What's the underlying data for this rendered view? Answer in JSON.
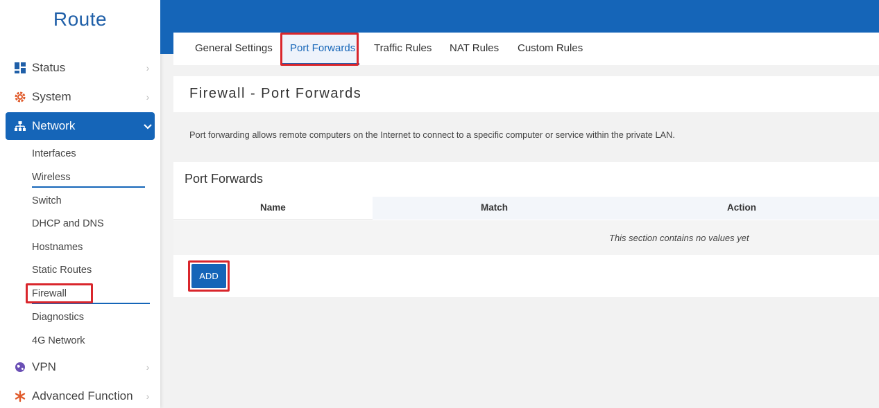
{
  "brand": "Route",
  "colors": {
    "primary": "#1565b8",
    "highlight": "#d9262c",
    "system_icon": "#e05a2b",
    "vpn_icon": "#6a4fb5",
    "advanced_icon": "#e05a2b"
  },
  "sidebar": {
    "items": [
      {
        "label": "Status",
        "icon": "dashboard-icon"
      },
      {
        "label": "System",
        "icon": "gear-icon"
      },
      {
        "label": "Network",
        "icon": "network-tree-icon"
      },
      {
        "label": "VPN",
        "icon": "vpn-globe-icon"
      },
      {
        "label": "Advanced Function",
        "icon": "asterisk-icon"
      }
    ],
    "network_sub": [
      "Interfaces",
      "Wireless",
      "Switch",
      "DHCP and DNS",
      "Hostnames",
      "Static Routes",
      "Firewall",
      "Diagnostics",
      "4G Network"
    ]
  },
  "tabs": [
    "General Settings",
    "Port Forwards",
    "Traffic Rules",
    "NAT Rules",
    "Custom Rules"
  ],
  "page": {
    "title": "Firewall - Port Forwards",
    "description": "Port forwarding allows remote computers on the Internet to connect to a specific computer or service within the private LAN."
  },
  "section": {
    "title": "Port Forwards",
    "columns": [
      "Name",
      "Match",
      "Action"
    ],
    "empty_text": "This section contains no values yet",
    "add_label": "ADD"
  }
}
